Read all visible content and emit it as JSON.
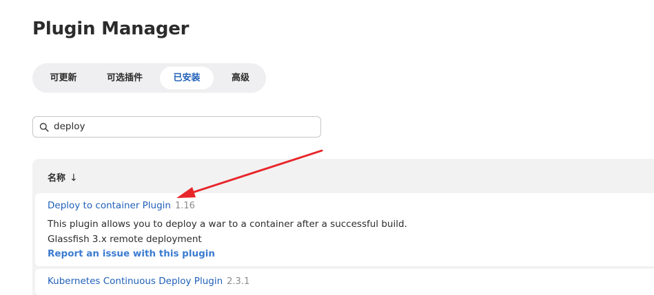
{
  "page_title": "Plugin Manager",
  "tabs": [
    {
      "label": "可更新",
      "active": false
    },
    {
      "label": "可选插件",
      "active": false
    },
    {
      "label": "已安装",
      "active": true
    },
    {
      "label": "高级",
      "active": false
    }
  ],
  "search": {
    "value": "deploy",
    "icon": "search-icon"
  },
  "table": {
    "column_name": "名称",
    "sort_indicator": "↓",
    "plugins": [
      {
        "name": "Deploy to container Plugin",
        "version": "1.16",
        "description_lines": [
          "This plugin allows you to deploy a war to a container after a successful build.",
          "Glassfish 3.x remote deployment"
        ],
        "report_link": "Report an issue with this plugin"
      },
      {
        "name": "Kubernetes Continuous Deploy Plugin",
        "version": "2.3.1"
      }
    ]
  },
  "colors": {
    "link": "#1f5fb8",
    "active_tab_text": "#1f5fb8",
    "annotation_arrow": "#e8262a"
  }
}
